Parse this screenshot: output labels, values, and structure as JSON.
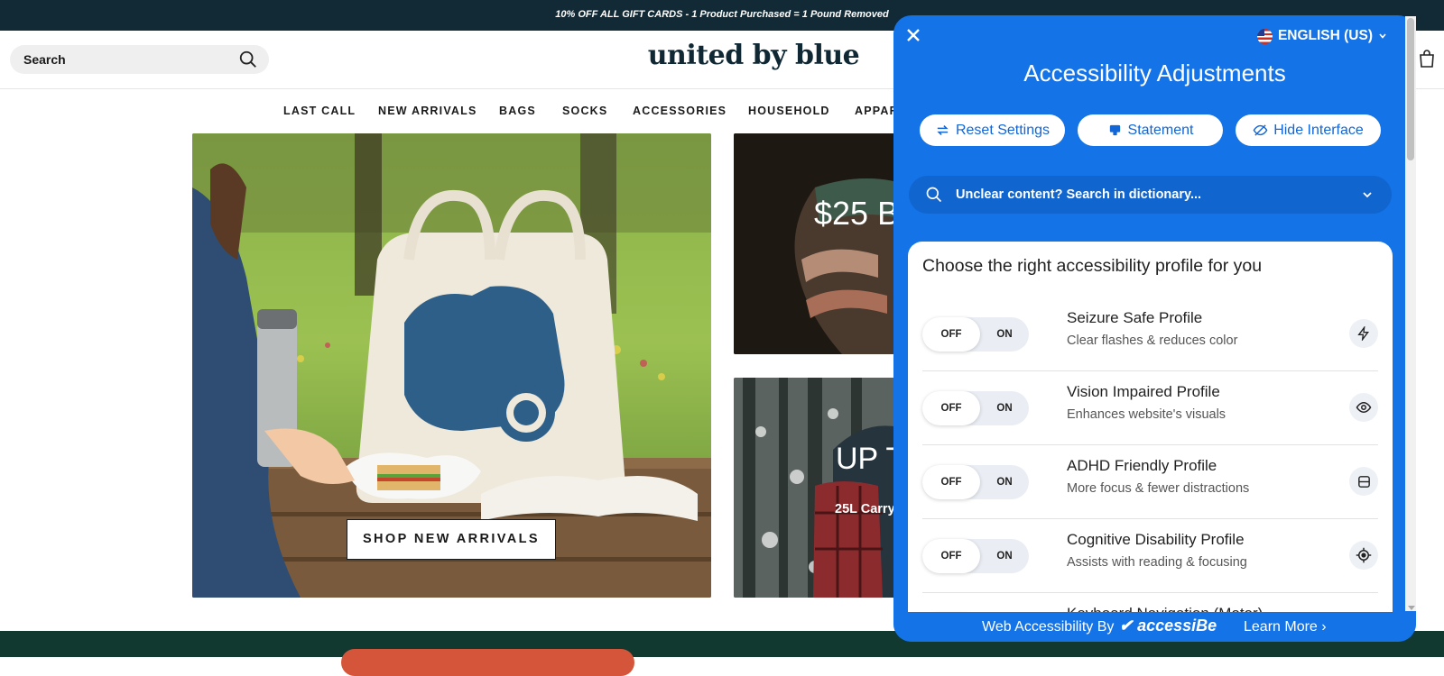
{
  "announcement": "10% OFF ALL GIFT CARDS - 1 Product Purchased = 1 Pound Removed",
  "header": {
    "search_label": "Search",
    "logo": "united by blue"
  },
  "nav": {
    "items": [
      "LAST CALL",
      "NEW ARRIVALS",
      "BAGS",
      "SOCKS",
      "ACCESSORIES",
      "HOUSEHOLD",
      "APPAR"
    ]
  },
  "hero": {
    "shop_button": "SHOP NEW ARRIVALS",
    "right_top_text": "$25 B",
    "right_bottom_heading": "UP T",
    "right_bottom_sub": "25L Carry"
  },
  "accessibility": {
    "language": "ENGLISH (US)",
    "title": "Accessibility Adjustments",
    "buttons": {
      "reset": "Reset Settings",
      "statement": "Statement",
      "hide": "Hide Interface"
    },
    "search_placeholder": "Unclear content? Search in dictionary...",
    "card_heading": "Choose the right accessibility profile for you",
    "toggle_off": "OFF",
    "toggle_on": "ON",
    "profiles": [
      {
        "title": "Seizure Safe Profile",
        "desc": "Clear flashes & reduces color",
        "icon": "bolt-icon",
        "state": "OFF"
      },
      {
        "title": "Vision Impaired Profile",
        "desc": "Enhances website's visuals",
        "icon": "eye-icon",
        "state": "OFF"
      },
      {
        "title": "ADHD Friendly Profile",
        "desc": "More focus & fewer distractions",
        "icon": "focus-frame-icon",
        "state": "OFF"
      },
      {
        "title": "Cognitive Disability Profile",
        "desc": "Assists with reading & focusing",
        "icon": "target-icon",
        "state": "OFF"
      },
      {
        "title": "Keyboard Navigation (Motor)",
        "desc": "",
        "icon": "",
        "state": "OFF"
      }
    ],
    "footer_by": "Web Accessibility By",
    "footer_brand": "accessiBe",
    "footer_learn": "Learn More ›"
  },
  "colors": {
    "announcement_bg": "#112a36",
    "panel_blue": "#1473e6",
    "footer_green": "#12392f",
    "footer_cta": "#d5553a"
  }
}
